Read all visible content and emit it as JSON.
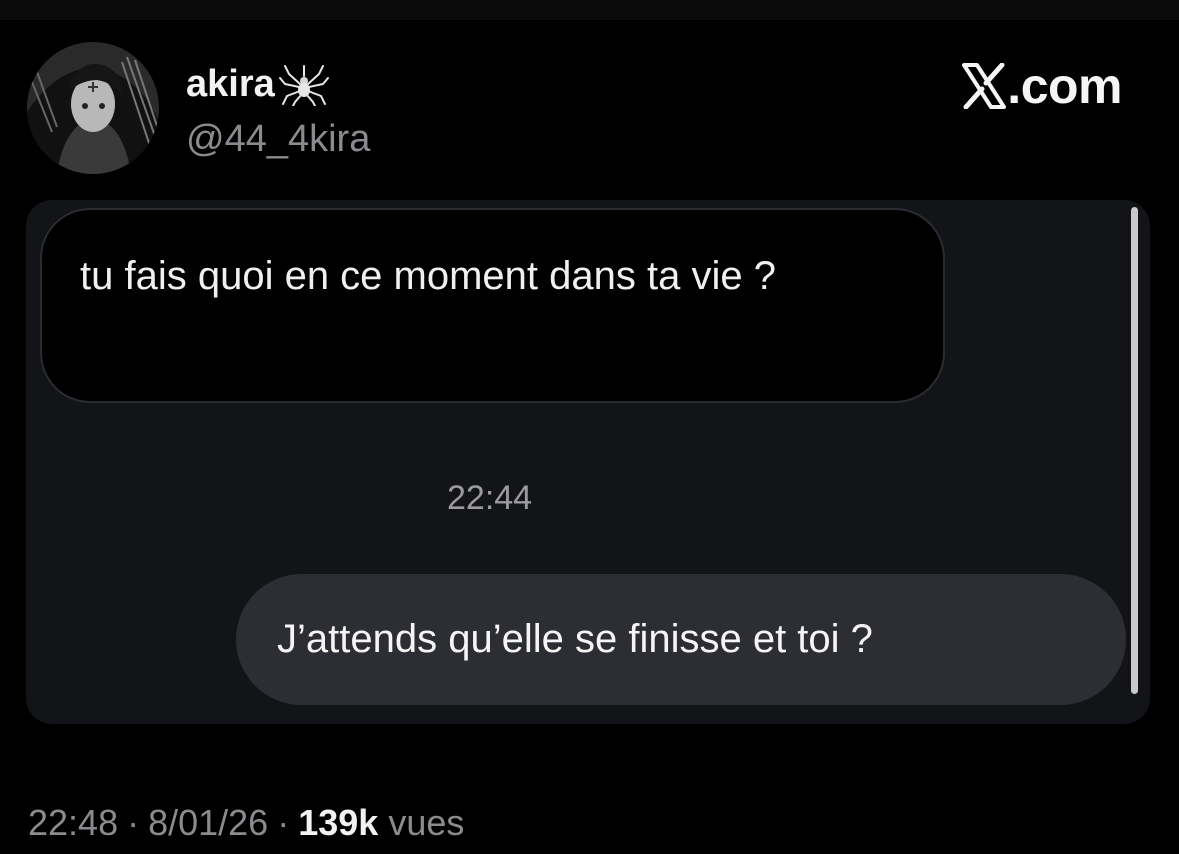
{
  "profile": {
    "display_name": "akira",
    "badge_icon": "spider-icon",
    "handle": "@44_4kira",
    "avatar_icon": "avatar-image"
  },
  "brand": {
    "logo_icon": "x-logo-icon",
    "text": ".com"
  },
  "conversation": {
    "incoming": {
      "text": "tu fais quoi en ce moment dans ta vie ?"
    },
    "timestamp": "22:44",
    "outgoing": {
      "text": "J’attends qu’elle se finisse et toi ?"
    }
  },
  "footer": {
    "time": "22:48",
    "separator": "·",
    "date": "8/01/26",
    "views_count": "139k",
    "views_label": "vues"
  },
  "colors": {
    "background": "#000000",
    "panel": "#131418",
    "outgoing_bubble": "#2d2e33",
    "muted_text": "#8b8b8f"
  }
}
